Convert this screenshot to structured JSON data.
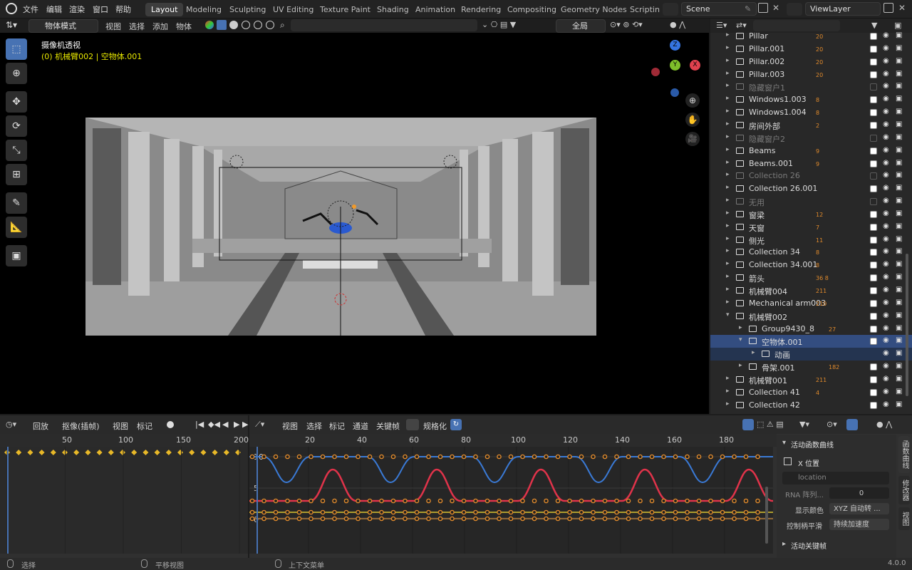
{
  "app_menu": [
    "文件",
    "编辑",
    "渲染",
    "窗口",
    "帮助"
  ],
  "workspaces": [
    "Layout",
    "Modeling",
    "Sculpting",
    "UV Editing",
    "Texture Paint",
    "Shading",
    "Animation",
    "Rendering",
    "Compositing",
    "Geometry Nodes",
    "Scriptin"
  ],
  "scene": "Scene",
  "view_layer": "ViewLayer",
  "viewport": {
    "mode": "物体模式",
    "menus": [
      "视图",
      "选择",
      "添加",
      "物体"
    ],
    "transform_orient": "全局",
    "overlay_title": "摄像机透视",
    "overlay_sub": "(0) 机械臂002 | 空物体.001",
    "gizmo": {
      "z": "Z",
      "x": "X",
      "y": "Y"
    }
  },
  "outliner": {
    "rows": [
      {
        "name": "Pillar",
        "badge": "20",
        "dim": false,
        "ind": 1
      },
      {
        "name": "Pillar.001",
        "badge": "20",
        "dim": false,
        "ind": 1
      },
      {
        "name": "Pillar.002",
        "badge": "20",
        "dim": false,
        "ind": 1
      },
      {
        "name": "Pillar.003",
        "badge": "20",
        "dim": false,
        "ind": 1
      },
      {
        "name": "隐藏窗户1",
        "badge": "",
        "dim": true,
        "ind": 1
      },
      {
        "name": "Windows1.003",
        "badge": "8",
        "dim": false,
        "ind": 1
      },
      {
        "name": "Windows1.004",
        "badge": "8",
        "dim": false,
        "ind": 1
      },
      {
        "name": "房间外部",
        "badge": "2",
        "dim": false,
        "ind": 1
      },
      {
        "name": "隐藏窗户2",
        "badge": "",
        "dim": true,
        "ind": 1
      },
      {
        "name": "Beams",
        "badge": "9",
        "dim": false,
        "ind": 1
      },
      {
        "name": "Beams.001",
        "badge": "9",
        "dim": false,
        "ind": 1
      },
      {
        "name": "Collection 26",
        "badge": "",
        "dim": true,
        "ind": 1
      },
      {
        "name": "Collection 26.001",
        "badge": "",
        "dim": false,
        "ind": 1
      },
      {
        "name": "无用",
        "badge": "",
        "dim": true,
        "ind": 1
      },
      {
        "name": "窗梁",
        "badge": "12",
        "dim": false,
        "ind": 1
      },
      {
        "name": "天窗",
        "badge": "7",
        "dim": false,
        "ind": 1
      },
      {
        "name": "侧光",
        "badge": "11",
        "dim": false,
        "ind": 1
      },
      {
        "name": "Collection 34",
        "badge": "8",
        "dim": false,
        "ind": 1
      },
      {
        "name": "Collection 34.001",
        "badge": "8",
        "dim": false,
        "ind": 1
      },
      {
        "name": "箭头",
        "badge": "36 8",
        "dim": false,
        "ind": 1
      },
      {
        "name": "机械臂004",
        "badge": "211",
        "dim": false,
        "ind": 1
      },
      {
        "name": "Mechanical arm003",
        "badge": "210",
        "dim": false,
        "ind": 1
      },
      {
        "name": "机械臂002",
        "badge": "",
        "dim": false,
        "ind": 1
      },
      {
        "name": "Group9430_8",
        "badge": "27",
        "dim": false,
        "ind": 2
      },
      {
        "name": "空物体.001",
        "badge": "",
        "dim": false,
        "ind": 2,
        "sel": true
      },
      {
        "name": "动画",
        "badge": "",
        "dim": false,
        "ind": 3,
        "sub": true
      },
      {
        "name": "骨架.001",
        "badge": "182",
        "dim": false,
        "ind": 2
      },
      {
        "name": "机械臂001",
        "badge": "211",
        "dim": false,
        "ind": 1
      },
      {
        "name": "Collection 41",
        "badge": "4",
        "dim": false,
        "ind": 1
      },
      {
        "name": "Collection 42",
        "badge": "",
        "dim": false,
        "ind": 1
      }
    ]
  },
  "timeline": {
    "menus": [
      "回放",
      "抠像(插帧)",
      "视图",
      "标记"
    ],
    "current_frame": "0",
    "ruler": [
      "0",
      "50",
      "100",
      "150",
      "200"
    ]
  },
  "graph_editor": {
    "menus": [
      "视图",
      "选择",
      "标记",
      "通道",
      "关键帧"
    ],
    "normalize": "规格化",
    "current_frame": "0",
    "ruler": [
      "20",
      "40",
      "60",
      "80",
      "100",
      "120",
      "140",
      "160",
      "180"
    ],
    "y_labels": [
      "10",
      "5",
      "0"
    ]
  },
  "n_panel": {
    "section1": "活动函数曲线",
    "channel": "X 位置",
    "rna_path": "location",
    "rna_index_label": "RNA 阵列...",
    "rna_index": "0",
    "color_label": "显示颜色",
    "color_value": "XYZ 自动转 ...",
    "handle_label": "控制柄平滑",
    "handle_value": "持续加速度",
    "section2": "活动关键帧",
    "tabs": [
      "函数曲线",
      "修改器",
      "视图"
    ]
  },
  "status_bar": {
    "select": "选择",
    "pan": "平移视图",
    "context": "上下文菜单",
    "version": "4.0.0"
  },
  "colors": {
    "accent": "#4772b3",
    "selected_row": "#334d80",
    "keyframe": "#e08a2c",
    "curve_red": "#e0334a",
    "curve_blue": "#3a7ad6",
    "curve_yellow": "#d8c431"
  }
}
